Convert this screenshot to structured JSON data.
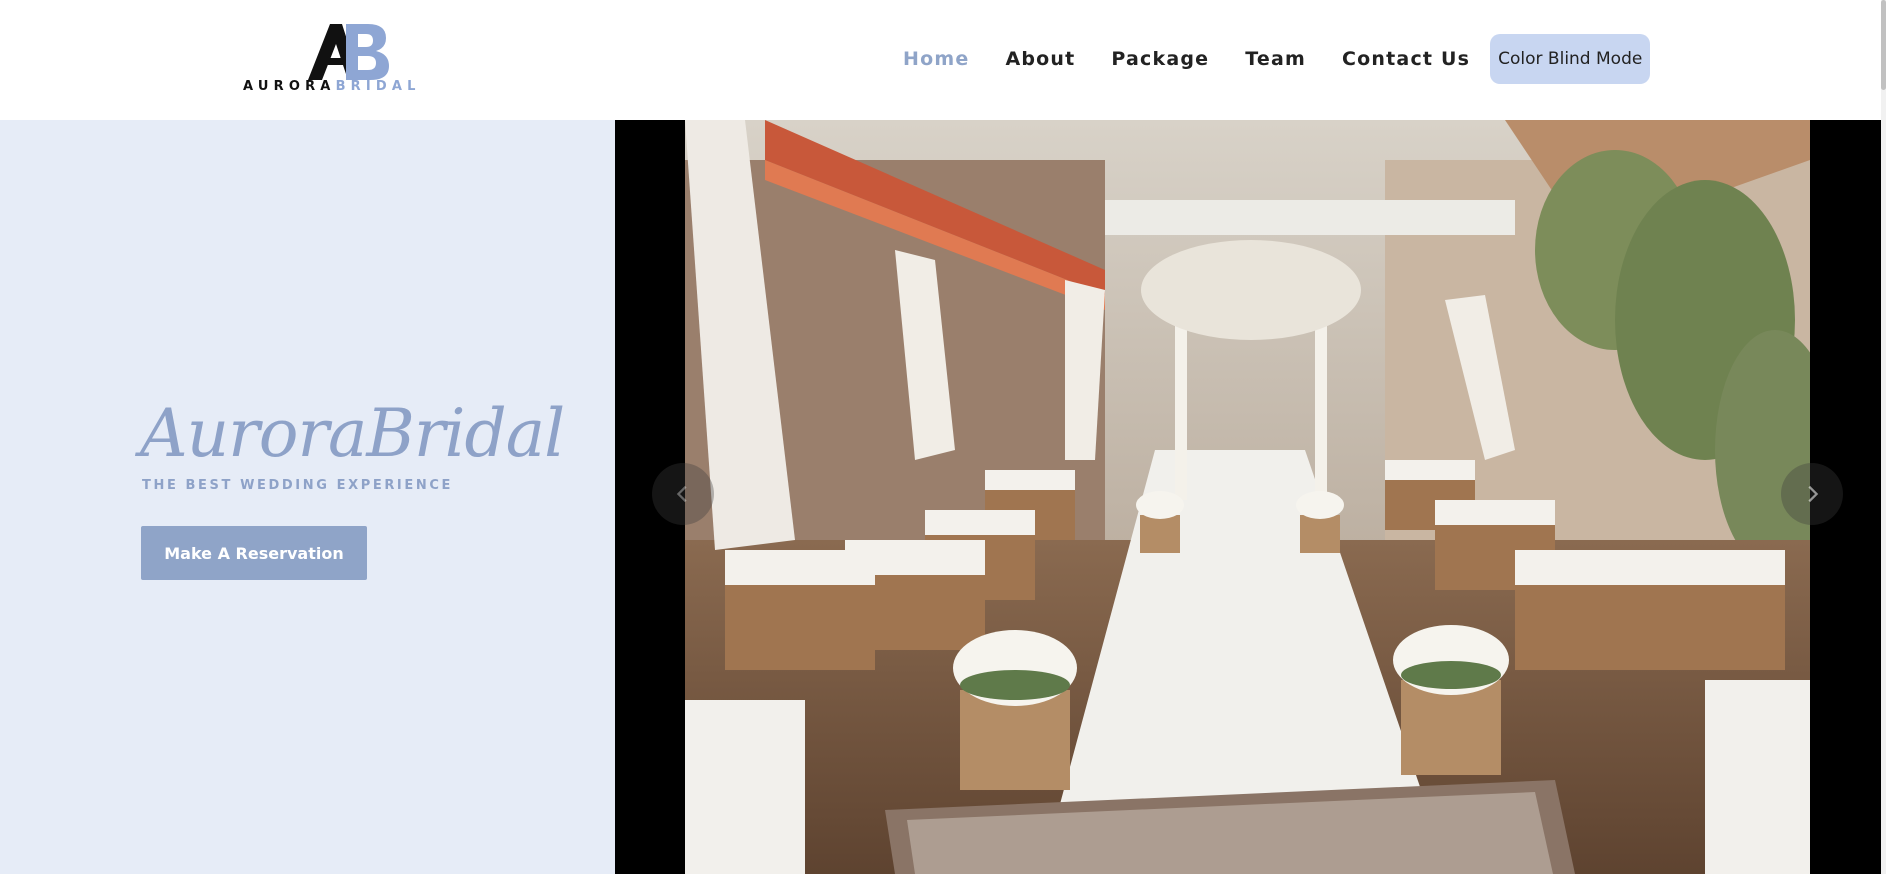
{
  "header": {
    "logo": {
      "monogram": "AB",
      "word_dark": "AURORA",
      "word_light": "BRIDAL"
    },
    "nav": [
      {
        "label": "Home",
        "active": true
      },
      {
        "label": "About",
        "active": false
      },
      {
        "label": "Package",
        "active": false
      },
      {
        "label": "Team",
        "active": false
      },
      {
        "label": "Contact Us",
        "active": false
      }
    ],
    "color_blind_button": "Color Blind Mode"
  },
  "hero": {
    "title": "AuroraBridal",
    "subtitle": "THE BEST WEDDING EXPERIENCE",
    "cta_label": "Make A Reservation",
    "slider": {
      "image_icon": "wedding-ceremony-aisle-photo",
      "prev_icon": "chevron-left-icon",
      "next_icon": "chevron-right-icon"
    }
  },
  "colors": {
    "accent": "#8fa4c8",
    "hero_bg": "#e6ecf7",
    "button_light": "#c8d6f1",
    "text_dark": "#222222"
  }
}
